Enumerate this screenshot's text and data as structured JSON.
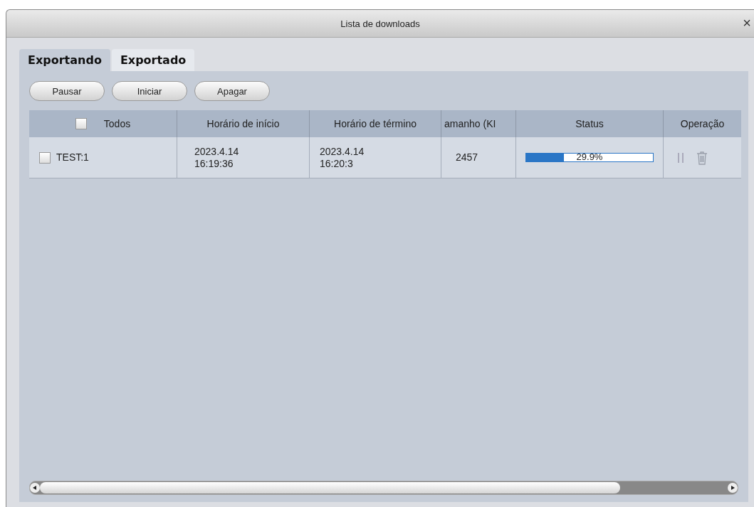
{
  "window": {
    "title": "Lista de downloads",
    "close": "×"
  },
  "tabs": [
    {
      "label": "Exportando",
      "selected": true
    },
    {
      "label": "Exportado",
      "selected": false
    }
  ],
  "buttons": [
    "Pausar",
    "Iniciar",
    "Apagar"
  ],
  "table": {
    "select_all": {
      "label": "Todos",
      "checked": false
    },
    "columns": [
      "Horário de início",
      "Horário de término",
      "amanho (KI",
      "Status",
      "Operação"
    ],
    "rows": [
      {
        "name": "TEST:1",
        "checked": false,
        "start": [
          "2023.4.14",
          "16:19:36"
        ],
        "end": [
          "2023.4.14",
          "16:20:3"
        ],
        "size": "2457",
        "level": 0.299,
        "progress": "29.9%"
      }
    ]
  }
}
